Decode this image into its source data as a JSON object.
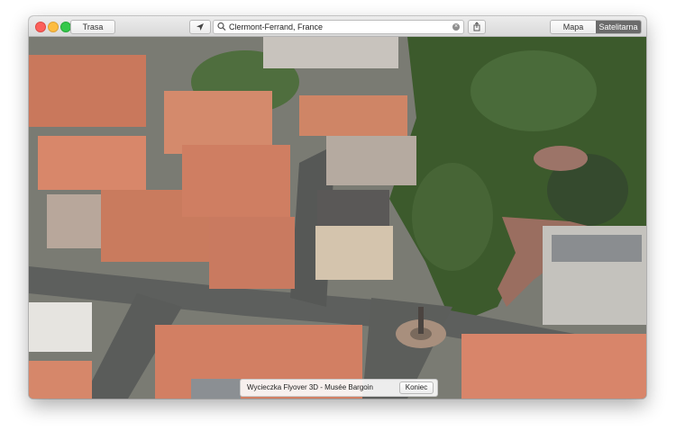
{
  "toolbar": {
    "route_label": "Trasa",
    "location_icon": "location-arrow-icon",
    "search_value": "Clermont-Ferrand, France",
    "share_icon": "share-icon",
    "map_mode": [
      "Mapa",
      "Satelitarna"
    ],
    "selected_mode": "Satelitarna"
  },
  "flyover": {
    "title": "Wycieczka Flyover 3D - Musée Bargoin",
    "end_label": "Koniec"
  }
}
